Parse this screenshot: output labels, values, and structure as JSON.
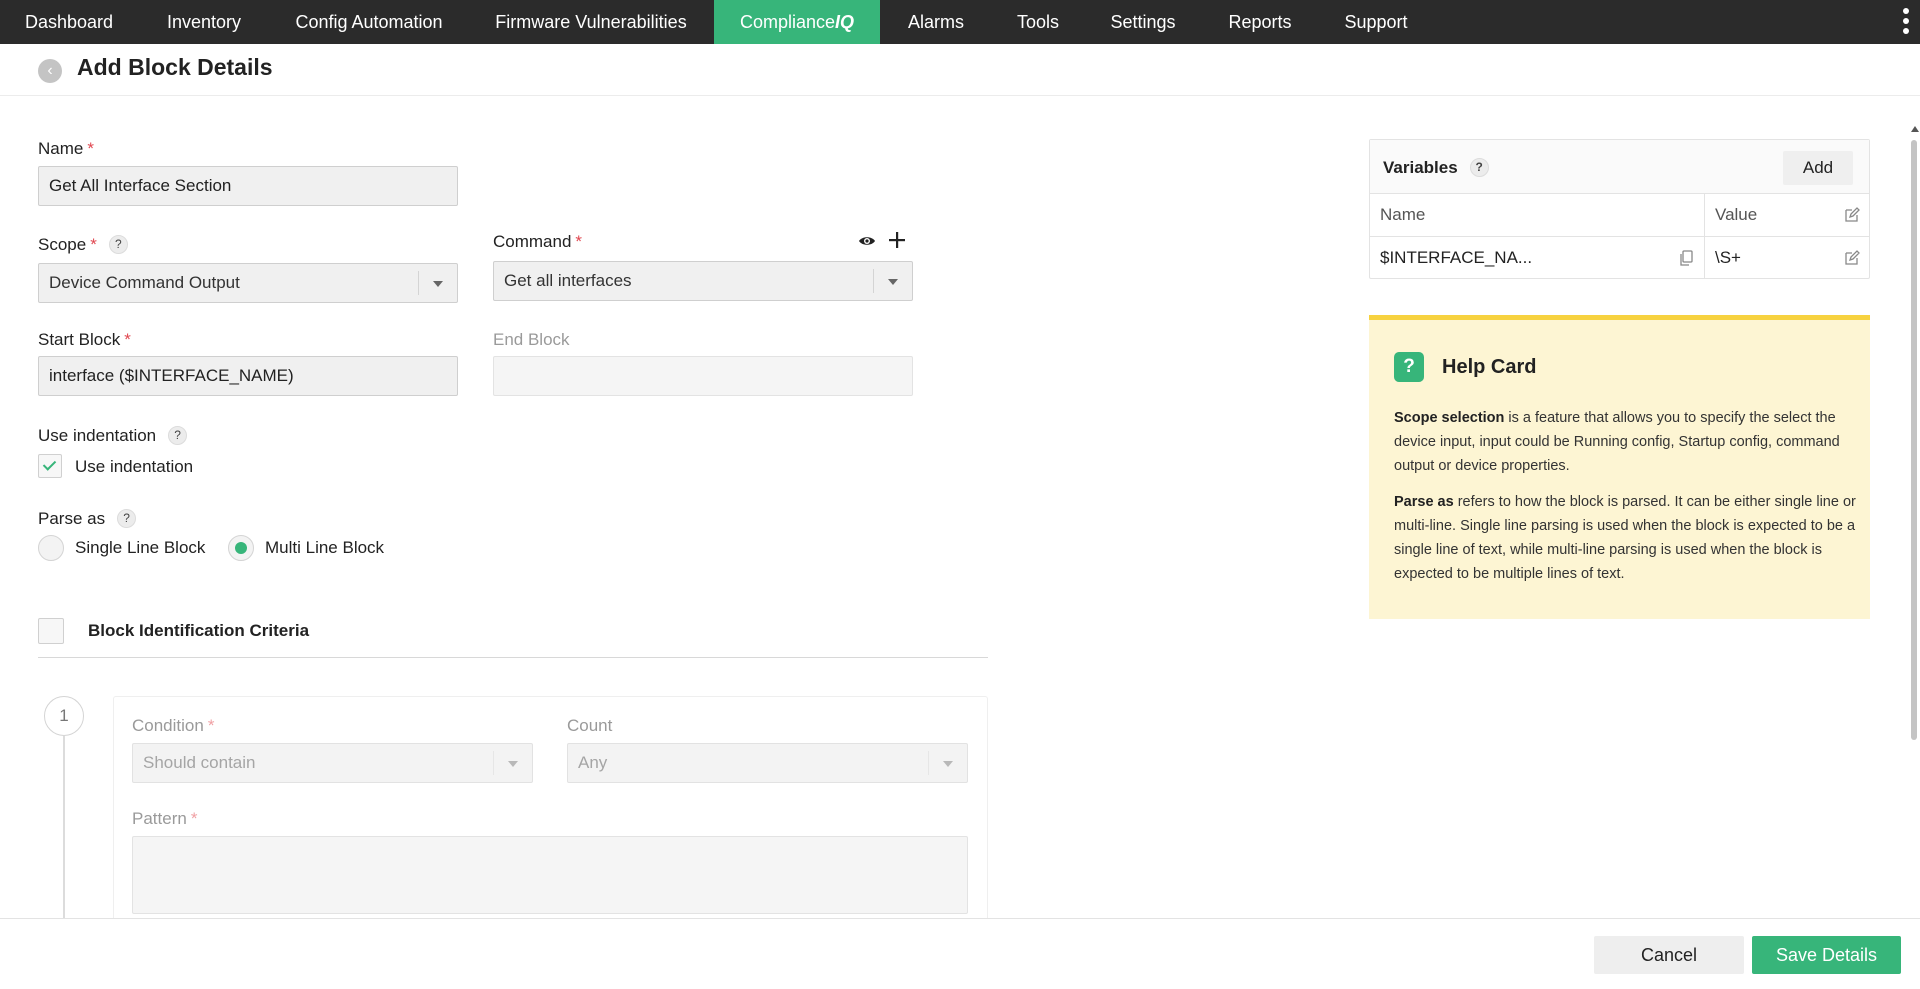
{
  "nav": {
    "items": [
      "Dashboard",
      "Inventory",
      "Config Automation",
      "Firmware Vulnerabilities"
    ],
    "active": {
      "prefix": "Compliance",
      "suffix": "IQ"
    },
    "items_after": [
      "Alarms",
      "Tools",
      "Settings",
      "Reports",
      "Support"
    ]
  },
  "header": {
    "title": "Add Block Details"
  },
  "form": {
    "name": {
      "label": "Name",
      "value": "Get All Interface Section"
    },
    "scope": {
      "label": "Scope",
      "value": "Device Command Output"
    },
    "command": {
      "label": "Command",
      "value": "Get all interfaces"
    },
    "start_block": {
      "label": "Start Block",
      "value": "interface ($INTERFACE_NAME)"
    },
    "end_block": {
      "label": "End Block",
      "value": ""
    },
    "use_indentation": {
      "label": "Use indentation",
      "option": "Use indentation",
      "checked": true
    },
    "parse_as": {
      "label": "Parse as",
      "options": [
        "Single Line Block",
        "Multi Line Block"
      ],
      "selected": "Multi Line Block"
    },
    "block_identification": {
      "title": "Block Identification Criteria",
      "checked": false
    },
    "criteria": {
      "step": "1",
      "condition": {
        "label": "Condition",
        "value": "Should contain"
      },
      "count": {
        "label": "Count",
        "value": "Any"
      },
      "pattern": {
        "label": "Pattern",
        "value": ""
      }
    }
  },
  "variables": {
    "title": "Variables",
    "add_label": "Add",
    "columns": [
      "Name",
      "Value"
    ],
    "rows": [
      {
        "name": "$INTERFACE_NA...",
        "value": "\\S+"
      }
    ]
  },
  "help_card": {
    "title": "Help Card",
    "badge": "?",
    "paragraphs": [
      {
        "term": "Scope selection",
        "text": " is a feature that allows you to specify the select the device input, input could be Running config, Startup config, command output or device properties."
      },
      {
        "term": "Parse as",
        "text": " refers to how the block is parsed. It can be either single line or multi-line. Single line parsing is used when the block is expected to be a single line of text, while multi-line parsing is used when the block is expected to be multiple lines of text."
      }
    ]
  },
  "footer": {
    "cancel": "Cancel",
    "save": "Save Details"
  },
  "colors": {
    "accent": "#37b57a",
    "nav_bg": "#2b2b2b",
    "required": "#e0464f",
    "help_bg": "#fdf5d3",
    "help_border": "#f7d23f"
  },
  "icons": {
    "back": "chevron-left-icon",
    "preview": "eye-icon",
    "add_command": "plus-icon",
    "copy": "copy-icon",
    "edit": "edit-icon",
    "help": "question-icon",
    "more": "kebab-menu-icon"
  }
}
